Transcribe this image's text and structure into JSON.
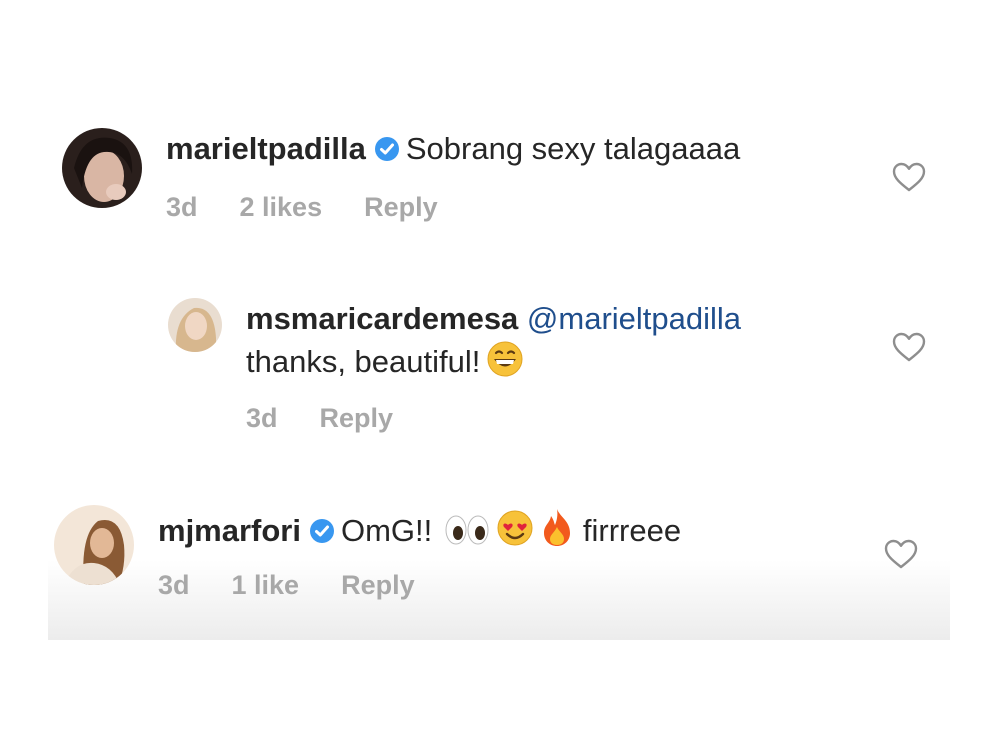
{
  "comments": [
    {
      "username": "marieltpadilla",
      "text": "Sobrang sexy talagaaaa",
      "time": "3d",
      "likes": "2 likes",
      "reply": "Reply"
    },
    {
      "username": "msmaricardemesa",
      "mention": "@marieltpadilla",
      "text": "thanks, beautiful!",
      "emoji": "grinning-face",
      "time": "3d",
      "reply": "Reply"
    },
    {
      "username": "mjmarfori",
      "text": "OmG!!",
      "emojis": [
        "eyes",
        "heart-eyes",
        "fire"
      ],
      "text_after": "firrreee",
      "time": "3d",
      "likes": "1 like",
      "reply": "Reply"
    }
  ],
  "colors": {
    "text": "#262626",
    "meta": "#a8a8a8",
    "mention": "#1f4e8c",
    "verified": "#3897f0"
  }
}
